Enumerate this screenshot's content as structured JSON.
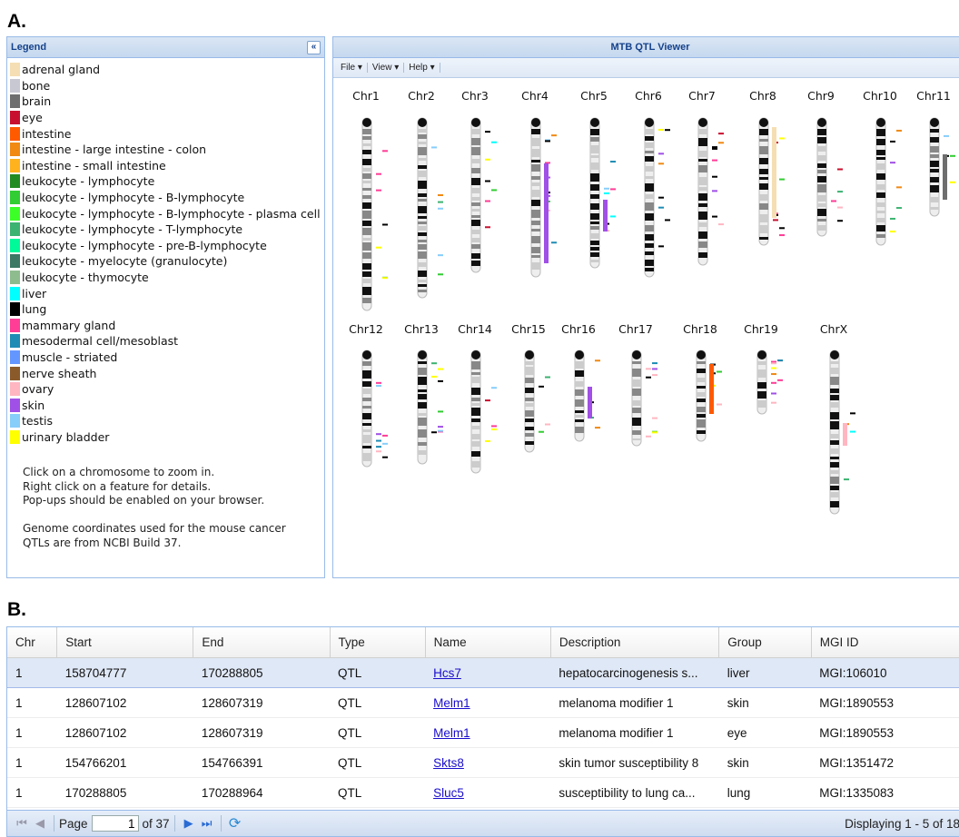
{
  "section_a": "A.",
  "section_b": "B.",
  "legend": {
    "title": "Legend",
    "collapse_glyph": "«",
    "items": [
      {
        "label": "adrenal gland",
        "color": "#f5deb3"
      },
      {
        "label": "bone",
        "color": "#c8c8d2"
      },
      {
        "label": "brain",
        "color": "#6e6e6e"
      },
      {
        "label": "eye",
        "color": "#c8102e"
      },
      {
        "label": "intestine",
        "color": "#ff5a00"
      },
      {
        "label": "intestine - large intestine - colon",
        "color": "#f08a14"
      },
      {
        "label": "intestine - small intestine",
        "color": "#ffb21e"
      },
      {
        "label": "leukocyte - lymphocyte",
        "color": "#228b22"
      },
      {
        "label": "leukocyte - lymphocyte - B-lymphocyte",
        "color": "#32cd32"
      },
      {
        "label": "leukocyte - lymphocyte - B-lymphocyte - plasma cell",
        "color": "#3cff28"
      },
      {
        "label": "leukocyte - lymphocyte - T-lymphocyte",
        "color": "#3cb371"
      },
      {
        "label": "leukocyte - lymphocyte - pre-B-lymphocyte",
        "color": "#00fa9a"
      },
      {
        "label": "leukocyte - myelocyte (granulocyte)",
        "color": "#3c7864"
      },
      {
        "label": "leukocyte - thymocyte",
        "color": "#8fbc8f"
      },
      {
        "label": "liver",
        "color": "#00ffff"
      },
      {
        "label": "lung",
        "color": "#000000"
      },
      {
        "label": "mammary gland",
        "color": "#ff3c96"
      },
      {
        "label": "mesodermal cell/mesoblast",
        "color": "#1e8cb4"
      },
      {
        "label": "muscle - striated",
        "color": "#6496ff"
      },
      {
        "label": "nerve sheath",
        "color": "#8b5a2b"
      },
      {
        "label": "ovary",
        "color": "#ffb6c1"
      },
      {
        "label": "skin",
        "color": "#a050e6"
      },
      {
        "label": "testis",
        "color": "#87cefa"
      },
      {
        "label": "urinary bladder",
        "color": "#ffff00"
      }
    ],
    "notes": [
      "Click on a chromosome to zoom in.",
      "Right click on a feature for details.",
      "Pop-ups should be enabled on your browser.",
      "",
      "Genome coordinates used for the mouse cancer",
      "QTLs are from NCBI Build 37."
    ]
  },
  "viewer": {
    "title": "MTB QTL Viewer",
    "menu": [
      "File ▾",
      "View ▾",
      "Help ▾"
    ],
    "row1": [
      "Chr1",
      "Chr2",
      "Chr3",
      "Chr4",
      "Chr5",
      "Chr6",
      "Chr7",
      "Chr8",
      "Chr9",
      "Chr10",
      "Chr11"
    ],
    "row2": [
      "Chr12",
      "Chr13",
      "Chr14",
      "Chr15",
      "Chr16",
      "Chr17",
      "Chr18",
      "Chr19",
      "ChrX"
    ]
  },
  "table": {
    "columns": [
      "Chr",
      "Start",
      "End",
      "Type",
      "Name",
      "Description",
      "Group",
      "MGI ID"
    ],
    "rows": [
      [
        "1",
        "158704777",
        "170288805",
        "QTL",
        "Hcs7",
        "hepatocarcinogenesis s...",
        "liver",
        "MGI:106010"
      ],
      [
        "1",
        "128607102",
        "128607319",
        "QTL",
        "Melm1",
        "melanoma modifier 1",
        "skin",
        "MGI:1890553"
      ],
      [
        "1",
        "128607102",
        "128607319",
        "QTL",
        "Melm1",
        "melanoma modifier 1",
        "eye",
        "MGI:1890553"
      ],
      [
        "1",
        "154766201",
        "154766391",
        "QTL",
        "Skts8",
        "skin tumor susceptibility 8",
        "skin",
        "MGI:1351472"
      ],
      [
        "1",
        "170288805",
        "170288964",
        "QTL",
        "Sluc5",
        "susceptibility to lung ca...",
        "lung",
        "MGI:1335083"
      ]
    ],
    "selected_row": 0
  },
  "paging": {
    "page_label": "Page",
    "page_value": "1",
    "of_label": "of 37",
    "displaying": "Displaying 1 - 5 of 18"
  }
}
